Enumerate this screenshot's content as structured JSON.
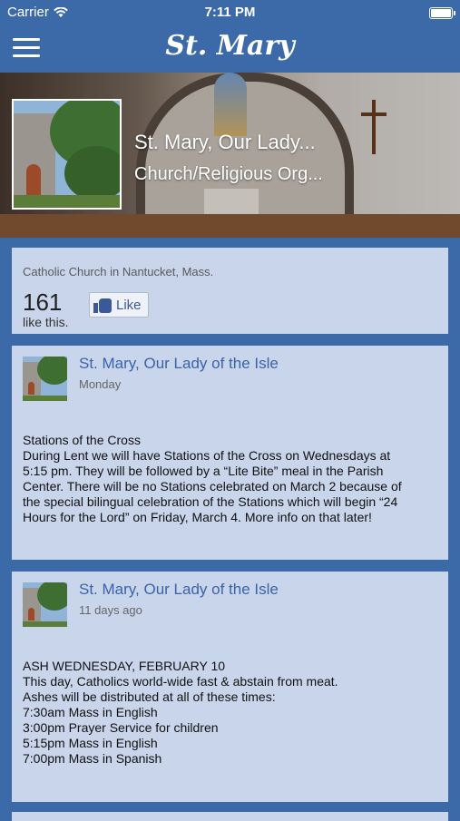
{
  "status_bar": {
    "carrier": "Carrier",
    "time": "7:11 PM",
    "battery_level": 1.0
  },
  "nav": {
    "title": "St. Mary",
    "menu_icon": "hamburger-menu-icon"
  },
  "cover": {
    "page_name": "St. Mary, Our Lady...",
    "category": "Church/Religious Org..."
  },
  "about": {
    "description": "Catholic Church in Nantucket, Mass.",
    "like_count": "161",
    "like_count_label": "like this.",
    "like_button_label": "Like"
  },
  "posts": [
    {
      "author": "St. Mary, Our Lady of the Isle",
      "time": "Monday",
      "body_lines": [
        "Stations of the Cross",
        "During Lent we will have Stations of the Cross on Wednesdays at",
        "5:15 pm. They will be followed by a “Lite Bite” meal in the Parish",
        "Center. There will be no Stations celebrated on March 2 because of",
        "the special bilingual celebration of the Stations which will begin “24",
        "Hours for the Lord” on Friday, March 4. More info on that later!"
      ]
    },
    {
      "author": "St. Mary, Our Lady of the Isle",
      "time": "11 days ago",
      "body_lines": [
        "ASH WEDNESDAY, FEBRUARY 10",
        "This day, Catholics world-wide fast & abstain from meat.",
        "Ashes will be distributed at all of these times:",
        "7:30am Mass in English",
        "3:00pm Prayer Service for children",
        "5:15pm Mass in English",
        "7:00pm Mass in Spanish"
      ]
    }
  ]
}
